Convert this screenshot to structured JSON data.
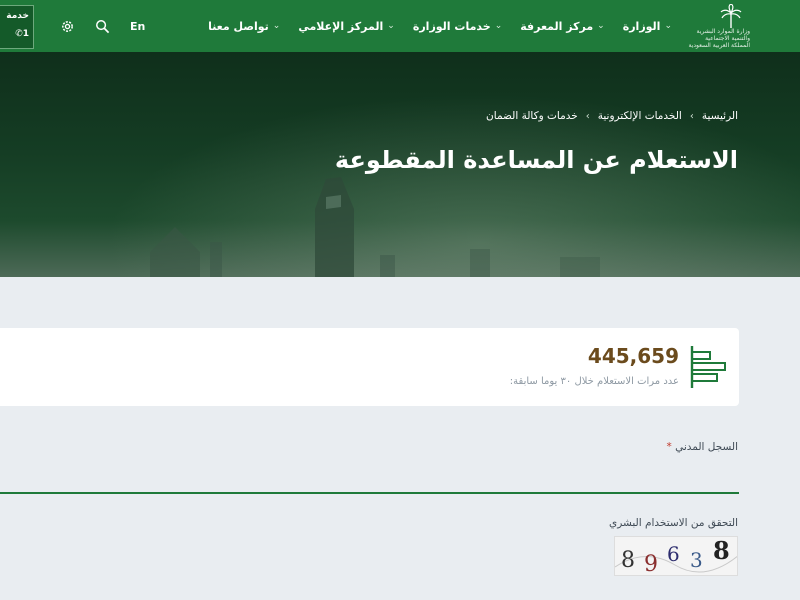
{
  "header": {
    "logo_lines": [
      "وزارة الموارد البشرية",
      "والتنمية الاجتماعية",
      "المملكة العربية السعودية"
    ],
    "nav": [
      {
        "label": "الوزارة",
        "has_dropdown": true
      },
      {
        "label": "مركز المعرفة",
        "has_dropdown": true
      },
      {
        "label": "خدمات الوزارة",
        "has_dropdown": true
      },
      {
        "label": "المركز الإعلامي",
        "has_dropdown": true
      },
      {
        "label": "تواصل معنا",
        "has_dropdown": true
      }
    ],
    "lang_label": "En",
    "search_icon": "search-icon",
    "settings_icon": "gear-icon",
    "service_btn": {
      "label": "خدمة",
      "number": "1"
    }
  },
  "hero": {
    "breadcrumb": [
      "الرئيسية",
      "الخدمات الإلكترونية",
      "خدمات وكالة الضمان"
    ],
    "title": "الاستعلام عن المساعدة المقطوعة"
  },
  "stats": {
    "count": "445,659",
    "label": "عدد مرات الاستعلام خلال ٣٠ يوما سابقة:"
  },
  "form": {
    "civil_id_label": "السجل المدني",
    "civil_id_required": "*",
    "civil_id_value": "",
    "captcha_label": "التحقق من الاستخدام البشري",
    "captcha_text": "89638"
  },
  "colors": {
    "brand_green": "#1f7a3a",
    "count_brown": "#6b4b1d",
    "page_bg": "#e9edf1"
  }
}
